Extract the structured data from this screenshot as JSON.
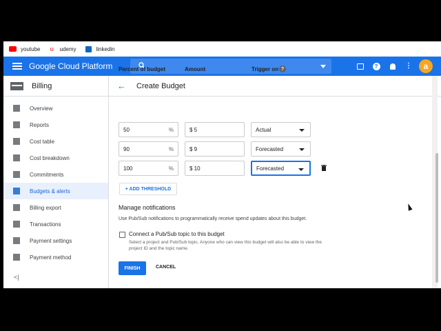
{
  "bookmarks": [
    {
      "label": "youtube",
      "icon": "youtube-icon",
      "color": "#ff0000"
    },
    {
      "label": "udemy",
      "icon": "udemy-icon",
      "color": "#ec5252"
    },
    {
      "label": "linkedin",
      "icon": "linkedin-icon",
      "color": "#0a66c2"
    }
  ],
  "header": {
    "title": "Google Cloud Platform",
    "avatar_letter": "a",
    "colors": {
      "bar": "#1a73e8",
      "avatar": "#f5a623"
    }
  },
  "sidebar": {
    "title": "Billing",
    "items": [
      {
        "label": "Overview",
        "icon": "overview-icon"
      },
      {
        "label": "Reports",
        "icon": "reports-icon"
      },
      {
        "label": "Cost table",
        "icon": "cost-table-icon"
      },
      {
        "label": "Cost breakdown",
        "icon": "cost-breakdown-icon"
      },
      {
        "label": "Commitments",
        "icon": "commitments-icon"
      },
      {
        "label": "Budgets & alerts",
        "icon": "budgets-icon",
        "active": true
      },
      {
        "label": "Billing export",
        "icon": "billing-export-icon"
      },
      {
        "label": "Transactions",
        "icon": "transactions-icon"
      },
      {
        "label": "Payment settings",
        "icon": "payment-settings-icon"
      },
      {
        "label": "Payment method",
        "icon": "payment-method-icon"
      }
    ],
    "collapse_label": "<|"
  },
  "main": {
    "title": "Create Budget",
    "columns": {
      "percent": "Percent of budget",
      "amount": "Amount",
      "trigger": "Trigger on"
    },
    "rows": [
      {
        "percent": "50",
        "pct_sign": "%",
        "amount": "$ 5",
        "trigger": "Actual"
      },
      {
        "percent": "90",
        "pct_sign": "%",
        "amount": "$ 9",
        "trigger": "Forecasted"
      },
      {
        "percent": "100",
        "pct_sign": "%",
        "amount": "$ 10",
        "trigger": "Forecasted"
      }
    ],
    "add_threshold": "+ ADD THRESHOLD",
    "notifications": {
      "title": "Manage notifications",
      "description": "Use Pub/Sub notifications to programmatically receive spend updates about this budget.",
      "checkbox_label": "Connect a Pub/Sub topic to this budget",
      "checkbox_desc": "Select a project and Pub/Sub topic. Anyone who can view this budget will also be able to view the project ID and the topic name."
    },
    "finish_label": "FINISH",
    "cancel_label": "CANCEL"
  }
}
